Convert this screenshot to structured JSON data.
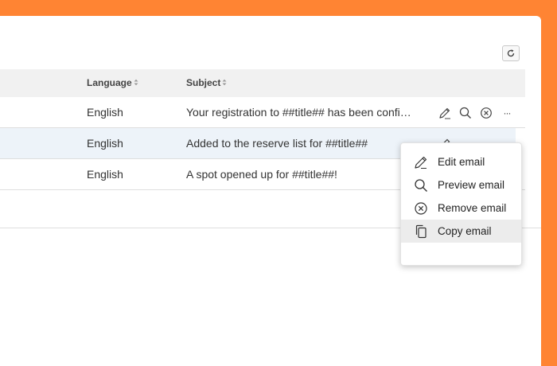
{
  "table": {
    "columns": [
      {
        "label": "Language",
        "sort_icon": "sort-updown-icon"
      },
      {
        "label": "Subject",
        "sort_icon": "sort-updown-icon"
      }
    ],
    "rows": [
      {
        "language": "English",
        "subject": "Your registration to ##title## has been confi…"
      },
      {
        "language": "English",
        "subject": "Added to the reserve list for ##title##"
      },
      {
        "language": "English",
        "subject": "A spot opened up for ##title##!"
      }
    ],
    "row_actions": [
      "pencil-icon",
      "search-icon",
      "close-circle-icon",
      "more-icon"
    ],
    "more_label": "···"
  },
  "toolbar": {
    "refresh_icon": "refresh-icon"
  },
  "context_menu": {
    "items": [
      {
        "label": "Edit email",
        "icon": "pencil-icon"
      },
      {
        "label": "Preview email",
        "icon": "search-icon"
      },
      {
        "label": "Remove email",
        "icon": "close-circle-icon"
      },
      {
        "label": "Copy email",
        "icon": "copy-icon",
        "hovered": true
      }
    ]
  },
  "colors": {
    "accent": "#ff8433",
    "header_bg": "#f1f1f1",
    "row_highlight": "#edf3f9",
    "menu_hover": "#ececec"
  }
}
